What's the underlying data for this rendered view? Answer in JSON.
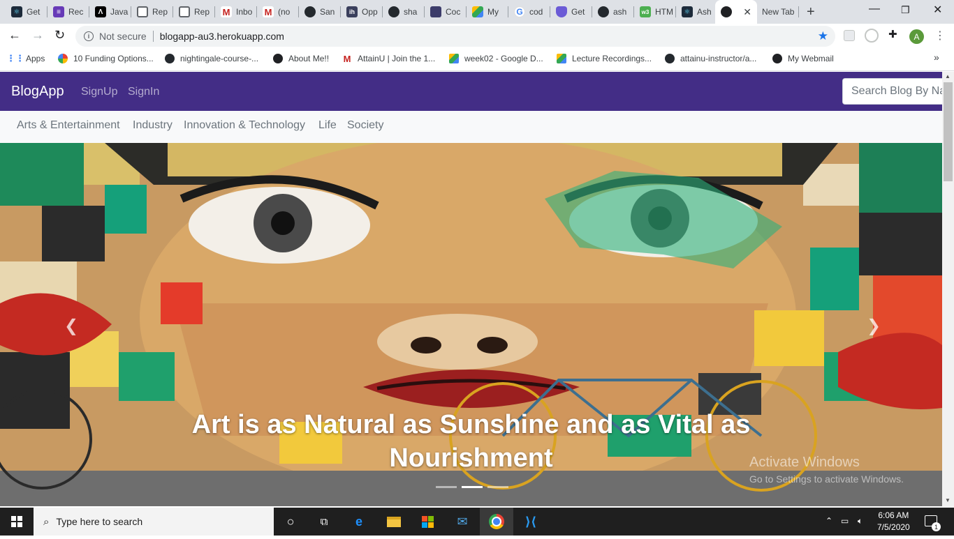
{
  "browser": {
    "tabs": [
      {
        "label": "Get",
        "icon": "react-icon",
        "color": "#1c2a3a"
      },
      {
        "label": "Rec",
        "icon": "form-icon",
        "color": "#673ab7"
      },
      {
        "label": "Java",
        "icon": "coding-site-icon",
        "color": "#000000"
      },
      {
        "label": "Rep",
        "icon": "replit-icon",
        "color": "#5f6368"
      },
      {
        "label": "Rep",
        "icon": "replit-icon",
        "color": "#5f6368"
      },
      {
        "label": "Inbo",
        "icon": "gmail-icon",
        "color": "#c5221f"
      },
      {
        "label": "(no",
        "icon": "gmail-icon",
        "color": "#c5221f"
      },
      {
        "label": "San",
        "icon": "github-icon",
        "color": "#24292e"
      },
      {
        "label": "Opp",
        "icon": "ih-icon",
        "color": "#3a3f5c"
      },
      {
        "label": "sha",
        "icon": "github-icon",
        "color": "#24292e"
      },
      {
        "label": "Coc",
        "icon": "coc-icon",
        "color": "#3c3c6a"
      },
      {
        "label": "My",
        "icon": "drive-icon",
        "color": "#34a853"
      },
      {
        "label": "cod",
        "icon": "google-icon",
        "color": "#4285f4"
      },
      {
        "label": "Get",
        "icon": "shield-icon",
        "color": "#6b5bd6"
      },
      {
        "label": "ash",
        "icon": "github-icon",
        "color": "#24292e"
      },
      {
        "label": "HTM",
        "icon": "html-icon",
        "color": "#4caf50"
      },
      {
        "label": "Ash",
        "icon": "react-icon",
        "color": "#1c2a3a"
      },
      {
        "label": "",
        "icon": "globe-icon",
        "color": "#202124",
        "active": true
      },
      {
        "label": "New Tab",
        "icon": "",
        "color": ""
      }
    ],
    "omnibox": {
      "security": "Not secure",
      "url": "blogapp-au3.herokuapp.com"
    },
    "profile_initial": "A",
    "bookmarks": [
      {
        "label": "Apps",
        "icon": "apps-grid-icon",
        "color": "#4285f4"
      },
      {
        "label": "10 Funding Options...",
        "icon": "pinwheel-icon",
        "color": "#e94235"
      },
      {
        "label": "nightingale-course-...",
        "icon": "github-icon",
        "color": "#24292e"
      },
      {
        "label": "About Me!!",
        "icon": "globe-icon",
        "color": "#202124"
      },
      {
        "label": "AttainU | Join the 1...",
        "icon": "gmail-icon",
        "color": "#c5221f"
      },
      {
        "label": "week02 - Google D...",
        "icon": "drive-icon",
        "color": "#34a853"
      },
      {
        "label": "Lecture Recordings...",
        "icon": "drive-icon",
        "color": "#34a853"
      },
      {
        "label": "attainu-instructor/a...",
        "icon": "github-icon",
        "color": "#24292e"
      },
      {
        "label": "My Webmail",
        "icon": "globe-icon",
        "color": "#202124"
      }
    ]
  },
  "app": {
    "brand": "BlogApp",
    "nav_links": [
      "SignUp",
      "SignIn"
    ],
    "search_placeholder": "Search Blog By Name",
    "categories": [
      "Arts & Entertainment",
      "Industry",
      "Innovation & Technology",
      "Life",
      "Society"
    ],
    "carousel": {
      "caption_line1": "Art is as Natural as Sunshine and as Vital as",
      "caption_line2": "Nourishment",
      "slide_count": 3,
      "active_index": 1
    }
  },
  "watermark": {
    "title": "Activate Windows",
    "subtitle": "Go to Settings to activate Windows."
  },
  "taskbar": {
    "search_placeholder": "Type here to search",
    "time": "6:06 AM",
    "date": "7/5/2020",
    "notification_count": "1"
  },
  "colors": {
    "navbar": "#432d86",
    "category_bar": "#f8f9fa",
    "tab_strip": "#dee1e6"
  }
}
